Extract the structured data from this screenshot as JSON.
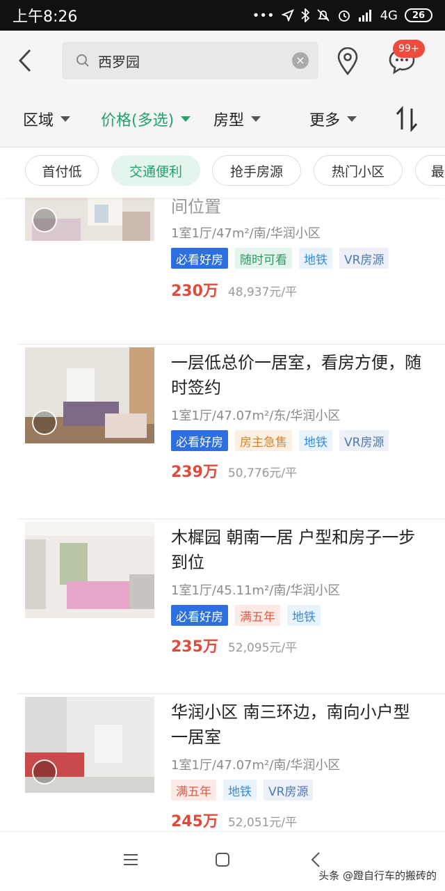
{
  "status_bar": {
    "time": "上午8:26",
    "network": "4G",
    "battery": "26"
  },
  "search": {
    "query": "西罗园",
    "message_badge": "99+"
  },
  "filters": [
    "区域",
    "价格(多选)",
    "房型",
    "更多"
  ],
  "quick_tags": [
    "首付低",
    "交通便利",
    "抢手房源",
    "热门小区",
    "最"
  ],
  "listings": [
    {
      "title": "间位置",
      "meta": "1室1厅/47m²/南/华润小区",
      "tags": [
        {
          "label": "必看好房",
          "style": "blue"
        },
        {
          "label": "随时可看",
          "style": "green"
        },
        {
          "label": "地铁",
          "style": "sub"
        },
        {
          "label": "VR房源",
          "style": "vr"
        }
      ],
      "price": "230万",
      "unit_price": "48,937元/平"
    },
    {
      "title": "一层低总价一居室，看房方便，随时签约",
      "meta": "1室1厅/47.07m²/东/华润小区",
      "tags": [
        {
          "label": "必看好房",
          "style": "blue"
        },
        {
          "label": "房主急售",
          "style": "orange"
        },
        {
          "label": "地铁",
          "style": "sub"
        },
        {
          "label": "VR房源",
          "style": "vr"
        }
      ],
      "price": "239万",
      "unit_price": "50,776元/平"
    },
    {
      "title": "木樨园  朝南一居 户型和房子一步到位",
      "meta": "1室1厅/45.11m²/南/华润小区",
      "tags": [
        {
          "label": "必看好房",
          "style": "blue"
        },
        {
          "label": "满五年",
          "style": "red"
        },
        {
          "label": "地铁",
          "style": "sub"
        }
      ],
      "price": "235万",
      "unit_price": "52,095元/平"
    },
    {
      "title": "华润小区 南三环边，南向小户型一居室",
      "meta": "1室1厅/47.07m²/南/华润小区",
      "tags": [
        {
          "label": "满五年",
          "style": "red"
        },
        {
          "label": "地铁",
          "style": "sub"
        },
        {
          "label": "VR房源",
          "style": "vr"
        }
      ],
      "price": "245万",
      "unit_price": "52,051元/平"
    }
  ],
  "watermark": "头条 @蹬自行车的搬砖的",
  "colors": {
    "accent_green": "#1fa36a",
    "price_red": "#e04a3c",
    "badge_red": "#f04a3c"
  }
}
